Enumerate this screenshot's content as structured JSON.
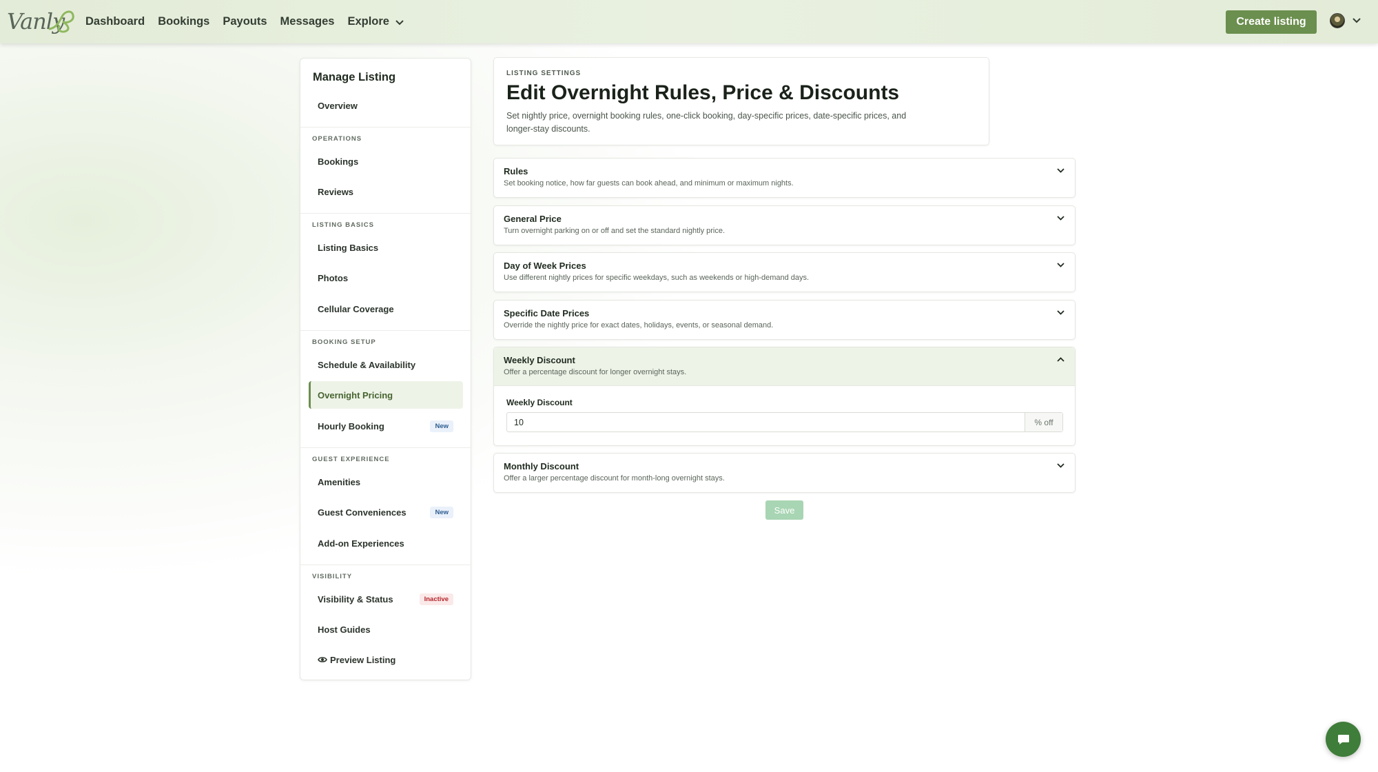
{
  "brand": {
    "logo_text": "Vanly"
  },
  "nav": {
    "items": [
      {
        "label": "Dashboard"
      },
      {
        "label": "Bookings"
      },
      {
        "label": "Payouts"
      },
      {
        "label": "Messages"
      },
      {
        "label": "Explore",
        "has_dropdown": true
      }
    ],
    "create_listing": "Create listing"
  },
  "sidebar": {
    "title": "Manage Listing",
    "overview": "Overview",
    "sections": {
      "operations": "OPERATIONS",
      "listing_basics": "LISTING BASICS",
      "booking_setup": "BOOKING SETUP",
      "guest_experience": "GUEST EXPERIENCE",
      "visibility": "VISIBILITY"
    },
    "items": {
      "bookings": "Bookings",
      "reviews": "Reviews",
      "listing_basics": "Listing Basics",
      "photos": "Photos",
      "cellular_coverage": "Cellular Coverage",
      "schedule": "Schedule & Availability",
      "overnight_pricing": "Overnight Pricing",
      "hourly_booking": "Hourly Booking",
      "amenities": "Amenities",
      "guest_conveniences": "Guest Conveniences",
      "addon_experiences": "Add-on Experiences",
      "visibility_status": "Visibility & Status",
      "host_guides": "Host Guides",
      "preview_listing": "Preview Listing"
    },
    "badges": {
      "new": "New",
      "inactive": "Inactive"
    },
    "active_item": "overnight_pricing"
  },
  "header": {
    "eyebrow": "LISTING SETTINGS",
    "title": "Edit Overnight Rules, Price & Discounts",
    "subtitle": "Set nightly price, overnight booking rules, one-click booking, day-specific prices, date-specific prices, and longer-stay discounts."
  },
  "sections": [
    {
      "title": "Rules",
      "desc": "Set booking notice, how far guests can book ahead, and minimum or maximum nights.",
      "open": false
    },
    {
      "title": "General Price",
      "desc": "Turn overnight parking on or off and set the standard nightly price.",
      "open": false
    },
    {
      "title": "Day of Week Prices",
      "desc": "Use different nightly prices for specific weekdays, such as weekends or high-demand days.",
      "open": false
    },
    {
      "title": "Specific Date Prices",
      "desc": "Override the nightly price for exact dates, holidays, events, or seasonal demand.",
      "open": false
    },
    {
      "title": "Weekly Discount",
      "desc": "Offer a percentage discount for longer overnight stays.",
      "open": true
    },
    {
      "title": "Monthly Discount",
      "desc": "Offer a larger percentage discount for month-long overnight stays.",
      "open": false
    }
  ],
  "weekly_discount_field": {
    "label": "Weekly Discount",
    "value": "10",
    "suffix": "% off"
  },
  "save_label": "Save",
  "colors": {
    "accent": "#6b8f4e",
    "save_disabled": "#a8d5b3",
    "chat": "#3f7d3a"
  }
}
